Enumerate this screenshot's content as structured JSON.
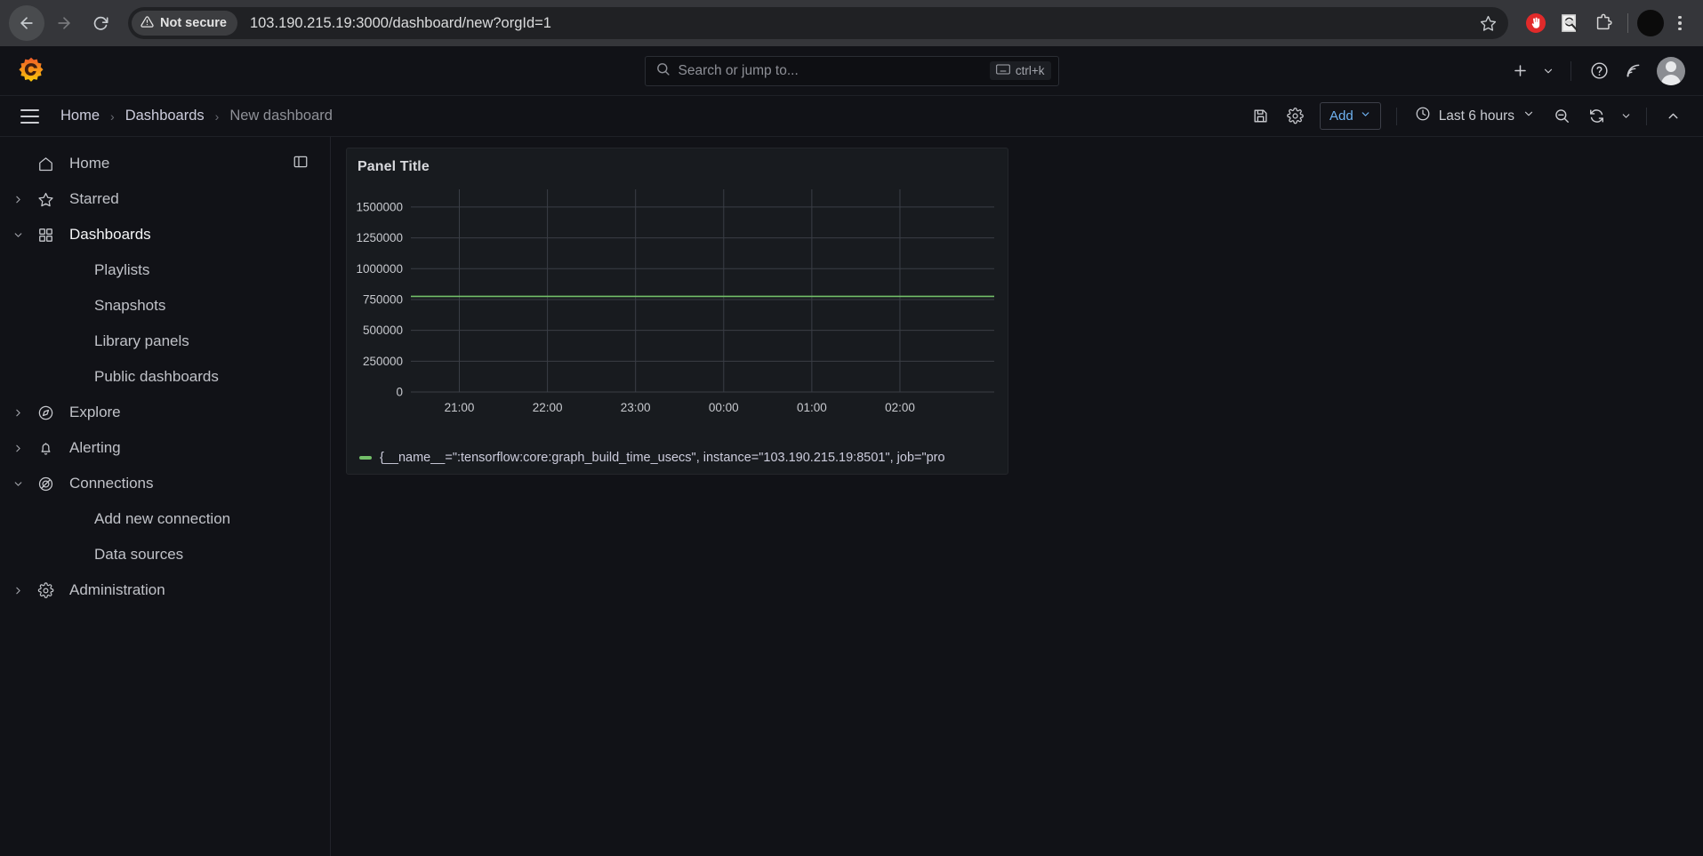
{
  "browser": {
    "back_label": "Back",
    "forward_label": "Forward",
    "reload_label": "Reload",
    "security_label": "Not secure",
    "url": "103.190.215.19:3000/dashboard/new?orgId=1",
    "bookmark_label": "Bookmark this tab",
    "extensions": [
      {
        "name": "adblock-icon",
        "label": "AdBlock"
      },
      {
        "name": "ocr-icon",
        "label": "OCR"
      },
      {
        "name": "puzzle-icon",
        "label": "Extensions"
      }
    ],
    "profile_label": "Profile",
    "menu_label": "Customize and control Google Chrome"
  },
  "topbar": {
    "logo_label": "Grafana",
    "search": {
      "placeholder": "Search or jump to...",
      "shortcut": "ctrl+k"
    },
    "actions": [
      {
        "name": "new-button",
        "label": "New"
      },
      {
        "name": "help-button",
        "label": "Help"
      },
      {
        "name": "news-button",
        "label": "News"
      }
    ],
    "profile_label": "Profile"
  },
  "navbar": {
    "menu_label": "Toggle menu",
    "breadcrumbs": [
      {
        "label": "Home"
      },
      {
        "label": "Dashboards"
      },
      {
        "label": "New dashboard"
      }
    ],
    "separator": "›",
    "toolbar": {
      "save_label": "Save dashboard",
      "settings_label": "Dashboard settings",
      "add_label": "Add",
      "time_range": "Last 6 hours",
      "zoom_out_label": "Zoom out time range",
      "refresh_label": "Refresh dashboard",
      "collapse_label": "Collapse toolbar"
    }
  },
  "sidebar": {
    "dock_label": "Dock menu",
    "items": [
      {
        "label": "Home",
        "icon": "home-icon",
        "expandable": false,
        "expanded": false,
        "selected": false,
        "sub": false
      },
      {
        "label": "Starred",
        "icon": "star-icon",
        "expandable": true,
        "expanded": false,
        "selected": false,
        "sub": false
      },
      {
        "label": "Dashboards",
        "icon": "apps-icon",
        "expandable": true,
        "expanded": true,
        "selected": true,
        "sub": false
      },
      {
        "label": "Playlists",
        "icon": "",
        "expandable": false,
        "expanded": false,
        "selected": false,
        "sub": true
      },
      {
        "label": "Snapshots",
        "icon": "",
        "expandable": false,
        "expanded": false,
        "selected": false,
        "sub": true
      },
      {
        "label": "Library panels",
        "icon": "",
        "expandable": false,
        "expanded": false,
        "selected": false,
        "sub": true
      },
      {
        "label": "Public dashboards",
        "icon": "",
        "expandable": false,
        "expanded": false,
        "selected": false,
        "sub": true
      },
      {
        "label": "Explore",
        "icon": "compass-icon",
        "expandable": true,
        "expanded": false,
        "selected": false,
        "sub": false
      },
      {
        "label": "Alerting",
        "icon": "bell-icon",
        "expandable": true,
        "expanded": false,
        "selected": false,
        "sub": false
      },
      {
        "label": "Connections",
        "icon": "connection-icon",
        "expandable": true,
        "expanded": true,
        "selected": false,
        "sub": false
      },
      {
        "label": "Add new connection",
        "icon": "",
        "expandable": false,
        "expanded": false,
        "selected": false,
        "sub": true
      },
      {
        "label": "Data sources",
        "icon": "",
        "expandable": false,
        "expanded": false,
        "selected": false,
        "sub": true
      },
      {
        "label": "Administration",
        "icon": "gear-icon",
        "expandable": true,
        "expanded": false,
        "selected": false,
        "sub": false
      }
    ]
  },
  "panel": {
    "title": "Panel Title",
    "legend_label": "{__name__=\":tensorflow:core:graph_build_time_usecs\", instance=\"103.190.215.19:8501\", job=\"pro",
    "series_color": "#73bf69"
  },
  "chart_data": {
    "type": "line",
    "title": "Panel Title",
    "xlabel": "",
    "ylabel": "",
    "grid": true,
    "legend_position": "bottom",
    "ylim": [
      0,
      1600000
    ],
    "yticks": [
      0,
      250000,
      500000,
      750000,
      1000000,
      1250000,
      1500000
    ],
    "ytick_labels": [
      "0",
      "250000",
      "500000",
      "750000",
      "1000000",
      "1250000",
      "1500000"
    ],
    "xticks": [
      "21:00",
      "22:00",
      "23:00",
      "00:00",
      "01:00",
      "02:00"
    ],
    "series": [
      {
        "name": "{__name__=\":tensorflow:core:graph_build_time_usecs\", instance=\"103.190.215.19:8501\", job=\"pro",
        "color": "#73bf69",
        "x": [
          "21:00",
          "22:00",
          "23:00",
          "00:00",
          "01:00",
          "02:00"
        ],
        "values": [
          775000,
          775000,
          775000,
          775000,
          775000,
          775000
        ]
      }
    ]
  }
}
